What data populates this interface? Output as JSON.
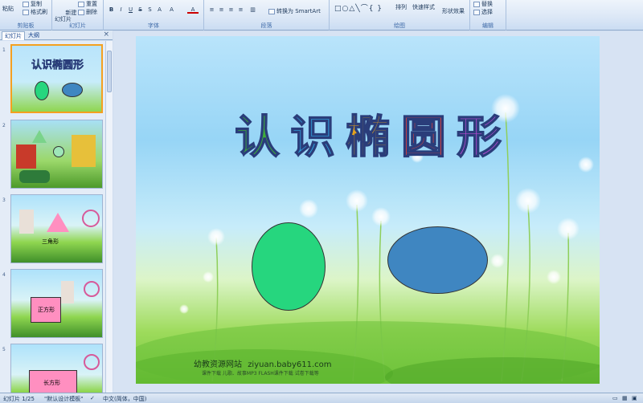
{
  "ribbon": {
    "groups": {
      "clipboard": "剪贴板",
      "slides": "幻灯片",
      "font": "字体",
      "paragraph": "段落",
      "drawing": "绘图",
      "editing": "编辑"
    },
    "buttons": {
      "paste": "粘贴",
      "copy": "复制",
      "format_painter": "格式刷",
      "new_slide": "新建\n幻灯片",
      "reset": "重置",
      "delete": "删除",
      "convert_smartart": "转换为 SmartArt",
      "arrange": "排列",
      "quick_styles": "快速样式",
      "shape_effects": "形状效果",
      "replace": "替换",
      "select": "选择"
    }
  },
  "tabs": {
    "slides": "幻灯片",
    "outline": "大纲",
    "close": "×"
  },
  "thumbnails": [
    {
      "num": "1",
      "selected": true
    },
    {
      "num": "2",
      "selected": false
    },
    {
      "num": "3",
      "selected": false,
      "label": "三角形"
    },
    {
      "num": "4",
      "selected": false,
      "label": "正方形"
    },
    {
      "num": "5",
      "selected": false,
      "label": "长方形"
    }
  ],
  "slide": {
    "title_chars": [
      "认",
      "识",
      "椭",
      "圆",
      "形"
    ],
    "title_colors": [
      "#3fae3a",
      "#2f9ad8",
      "#e6a21c",
      "#e2423c",
      "#b24ad0"
    ],
    "ellipse_green": "#26d67e",
    "ellipse_blue": "#3f86c1",
    "watermark": {
      "site_name": "幼教资源网站",
      "site_url": "ziyuan.baby611.com",
      "subtitle": "课件下载  儿歌、故事MP3  FLASH课件下载  试卷下载等"
    }
  },
  "status": {
    "slide_counter": "幻灯片 1/25",
    "theme": "\"默认设计模板\"",
    "language": "中文(简体，中国)"
  }
}
